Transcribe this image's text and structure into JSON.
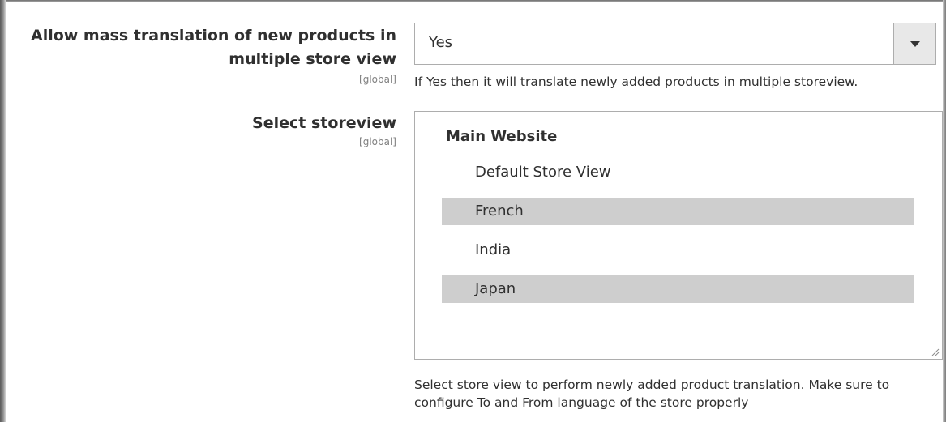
{
  "mass_translation": {
    "label": "Allow mass translation of new products in multiple store view",
    "scope": "[global]",
    "selected_value": "Yes",
    "note": "If Yes then it will translate newly added products in multiple storeview."
  },
  "storeview": {
    "label": "Select storeview",
    "scope": "[global]",
    "group_label": "Main Website",
    "options": [
      {
        "label": "Default Store View",
        "selected": false
      },
      {
        "label": "French",
        "selected": true
      },
      {
        "label": "India",
        "selected": false
      },
      {
        "label": "Japan",
        "selected": true
      }
    ],
    "note": "Select store view to perform newly added product translation. Make sure to configure To and From language of the store properly"
  },
  "icons": {
    "dropdown": "chevron-down-icon",
    "resize": "resize-grip-icon"
  },
  "colors": {
    "selected_option_bg": "#cecece",
    "border": "#adadad",
    "arrow_box_bg": "#e8e8e8",
    "text": "#303030",
    "scope_text": "#808080"
  }
}
